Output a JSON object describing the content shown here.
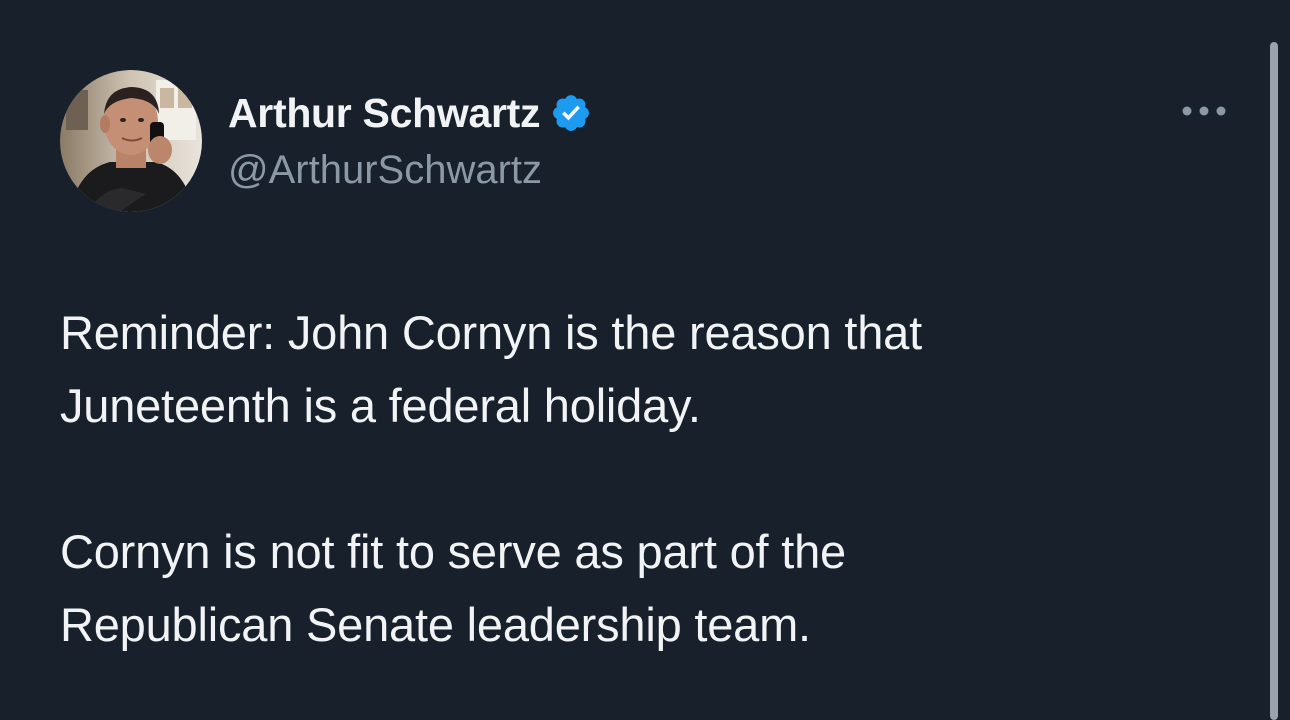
{
  "author": {
    "display_name": "Arthur Schwartz",
    "handle": "@ArthurSchwartz",
    "verified": true,
    "verified_icon": "verified-badge-icon",
    "avatar_icon": "profile-photo"
  },
  "menu": {
    "more_icon": "ellipsis-icon"
  },
  "tweet": {
    "paragraphs": [
      "Reminder: John Cornyn is the reason that\nJuneteenth is a federal holiday.",
      "Cornyn is not fit to serve as part of the\nRepublican Senate leadership team."
    ]
  },
  "colors": {
    "background": "#17202b",
    "text_primary": "#f1f3f4",
    "text_secondary": "#8b98a5",
    "verified_blue": "#1d9bf0",
    "scrollbar": "#9aa3ab"
  }
}
